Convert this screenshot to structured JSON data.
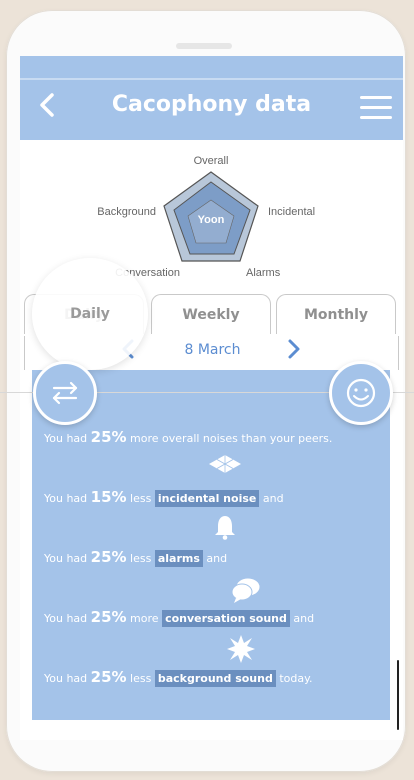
{
  "header": {
    "title": "Cacophony data",
    "back_icon": "chevron-left-icon",
    "menu_icon": "hamburger-icon"
  },
  "radar": {
    "axes": [
      "Overall",
      "Incidental",
      "Alarms",
      "Conversation",
      "Background"
    ],
    "center_label": "Yoon",
    "colors": {
      "fill": "#7d9dc7",
      "inner": "#a9bdd6",
      "stroke": "#555555"
    }
  },
  "tabs": [
    "Daily",
    "Weekly",
    "Monthly"
  ],
  "date": {
    "label": "8 March",
    "prev_icon": "chevron-left-icon",
    "next_icon": "chevron-right-icon"
  },
  "summary": {
    "rows": [
      {
        "prefix": "You had ",
        "pct": "25%",
        "middle": " more overall noises than your peers.",
        "tag": "",
        "suffix": ""
      },
      {
        "prefix": "You had ",
        "pct": "15%",
        "middle": " less ",
        "tag": "incidental noise",
        "suffix": " and"
      },
      {
        "prefix": "You had ",
        "pct": "25%",
        "middle": " less ",
        "tag": "alarms",
        "suffix": " and"
      },
      {
        "prefix": "You had ",
        "pct": "25%",
        "middle": " more ",
        "tag": "conversation sound",
        "suffix": " and"
      },
      {
        "prefix": "You had ",
        "pct": "25%",
        "middle": " less ",
        "tag": "background sound",
        "suffix": " today."
      }
    ],
    "icons": [
      "diamond-grid-icon",
      "bell-icon",
      "speech-bubbles-icon",
      "burst-icon"
    ]
  },
  "floating_buttons": {
    "left_icon": "swap-arrows-icon",
    "right_icon": "smiley-icon"
  },
  "colors": {
    "accent": "#a4c3e9",
    "accent_dark": "#5c8dd1",
    "tag_bg": "#6b8fbf",
    "page_bg": "#ece3d8"
  }
}
